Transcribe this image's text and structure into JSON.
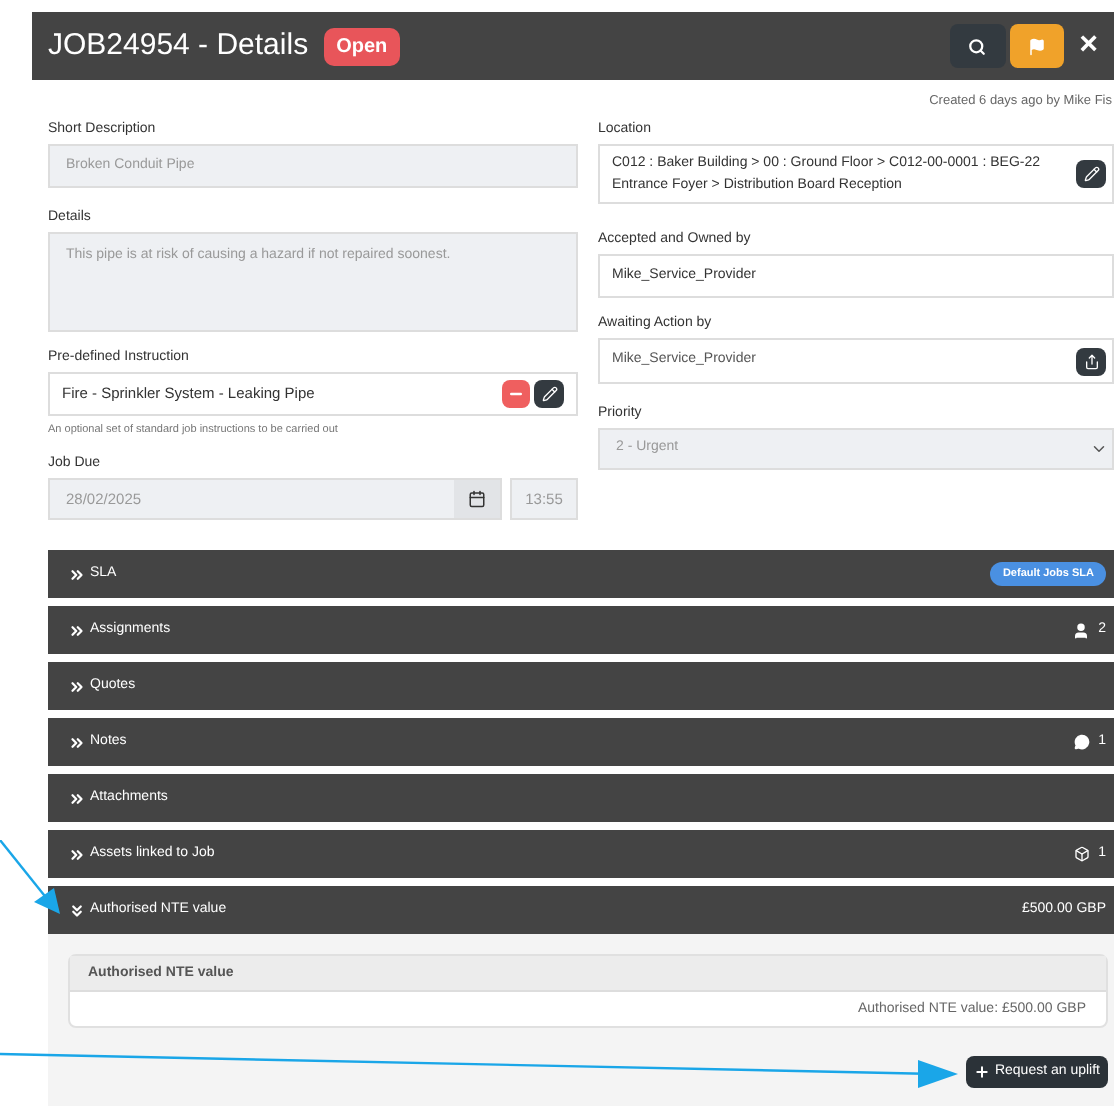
{
  "header": {
    "title": "JOB24954 - Details",
    "status": "Open",
    "close": "×"
  },
  "created": "Created 6 days ago by Mike Fis",
  "left": {
    "short_description": {
      "label": "Short Description",
      "value": "Broken Conduit Pipe",
      "disabled": true
    },
    "details": {
      "label": "Details",
      "value": "This pipe is at risk of causing a hazard if not repaired soonest.",
      "disabled": true
    },
    "instruction": {
      "label": "Pre-defined Instruction",
      "value": "Fire - Sprinkler System - Leaking Pipe",
      "help": "An optional set of standard job instructions to be carried out"
    },
    "job_due": {
      "label": "Job Due",
      "date": "28/02/2025",
      "time": "13:55"
    }
  },
  "right": {
    "location": {
      "label": "Location",
      "value": "C012 : Baker Building > 00 : Ground Floor > C012-00-0001 : BEG-22 Entrance Foyer > Distribution Board Reception"
    },
    "owner": {
      "label": "Accepted and Owned by",
      "value": "Mike_Service_Provider"
    },
    "awaiting": {
      "label": "Awaiting Action by",
      "value": "Mike_Service_Provider"
    },
    "priority": {
      "label": "Priority",
      "value": "2 - Urgent",
      "disabled": true
    }
  },
  "panels": [
    {
      "title": "SLA",
      "expanded": false,
      "kind": "badge",
      "extra": "Default Jobs SLA"
    },
    {
      "title": "Assignments",
      "expanded": false,
      "kind": "person",
      "extra": "2"
    },
    {
      "title": "Quotes",
      "expanded": false,
      "kind": "none"
    },
    {
      "title": "Notes",
      "expanded": false,
      "kind": "comment",
      "extra": "1"
    },
    {
      "title": "Attachments",
      "expanded": false,
      "kind": "none"
    },
    {
      "title": "Assets linked to Job",
      "expanded": false,
      "kind": "cube",
      "extra": "1"
    },
    {
      "title": "Authorised NTE value",
      "expanded": true,
      "kind": "text",
      "extra": "£500.00 GBP",
      "body": {
        "card_title": "Authorised NTE value",
        "card_value": "Authorised NTE value: £500.00 GBP",
        "button": "Request an uplift"
      }
    }
  ]
}
